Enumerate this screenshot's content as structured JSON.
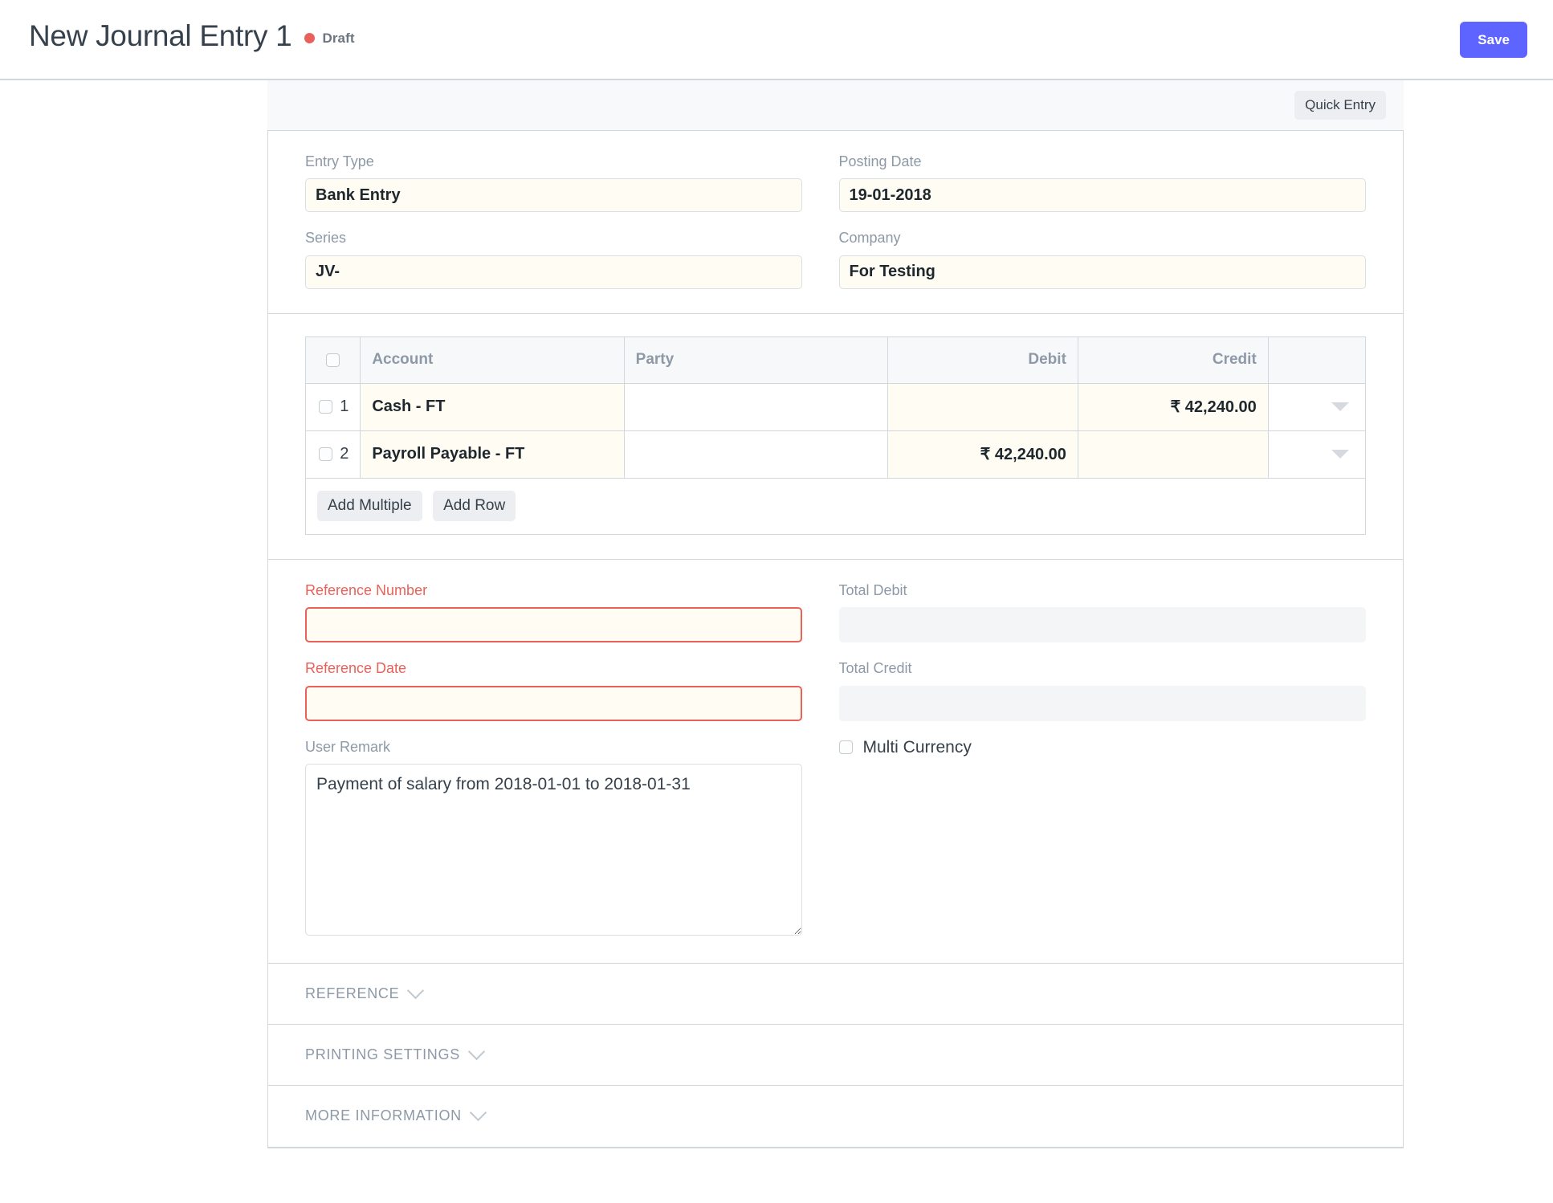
{
  "header": {
    "title": "New Journal Entry 1",
    "status_label": "Draft",
    "status_color": "#e8615a",
    "save_label": "Save",
    "save_color": "#5e64ff"
  },
  "toolbar": {
    "quick_entry_label": "Quick Entry"
  },
  "form": {
    "entry_type": {
      "label": "Entry Type",
      "value": "Bank Entry"
    },
    "posting_date": {
      "label": "Posting Date",
      "value": "19-01-2018"
    },
    "series": {
      "label": "Series",
      "value": "JV-"
    },
    "company": {
      "label": "Company",
      "value": "For Testing"
    },
    "reference_number": {
      "label": "Reference Number",
      "value": "",
      "required": true
    },
    "reference_date": {
      "label": "Reference Date",
      "value": "",
      "required": true
    },
    "user_remark": {
      "label": "User Remark",
      "value": "Payment of salary from 2018-01-01 to 2018-01-31"
    },
    "total_debit": {
      "label": "Total Debit",
      "value": ""
    },
    "total_credit": {
      "label": "Total Credit",
      "value": ""
    },
    "multi_currency": {
      "label": "Multi Currency",
      "checked": false
    }
  },
  "grid": {
    "columns": [
      "Account",
      "Party",
      "Debit",
      "Credit"
    ],
    "rows": [
      {
        "idx": "1",
        "account": "Cash - FT",
        "party": "",
        "debit": "",
        "credit": "₹ 42,240.00"
      },
      {
        "idx": "2",
        "account": "Payroll Payable - FT",
        "party": "",
        "debit": "₹ 42,240.00",
        "credit": ""
      }
    ],
    "add_multiple_label": "Add Multiple",
    "add_row_label": "Add Row"
  },
  "collapsibles": [
    {
      "title": "REFERENCE"
    },
    {
      "title": "PRINTING SETTINGS"
    },
    {
      "title": "MORE INFORMATION"
    }
  ]
}
